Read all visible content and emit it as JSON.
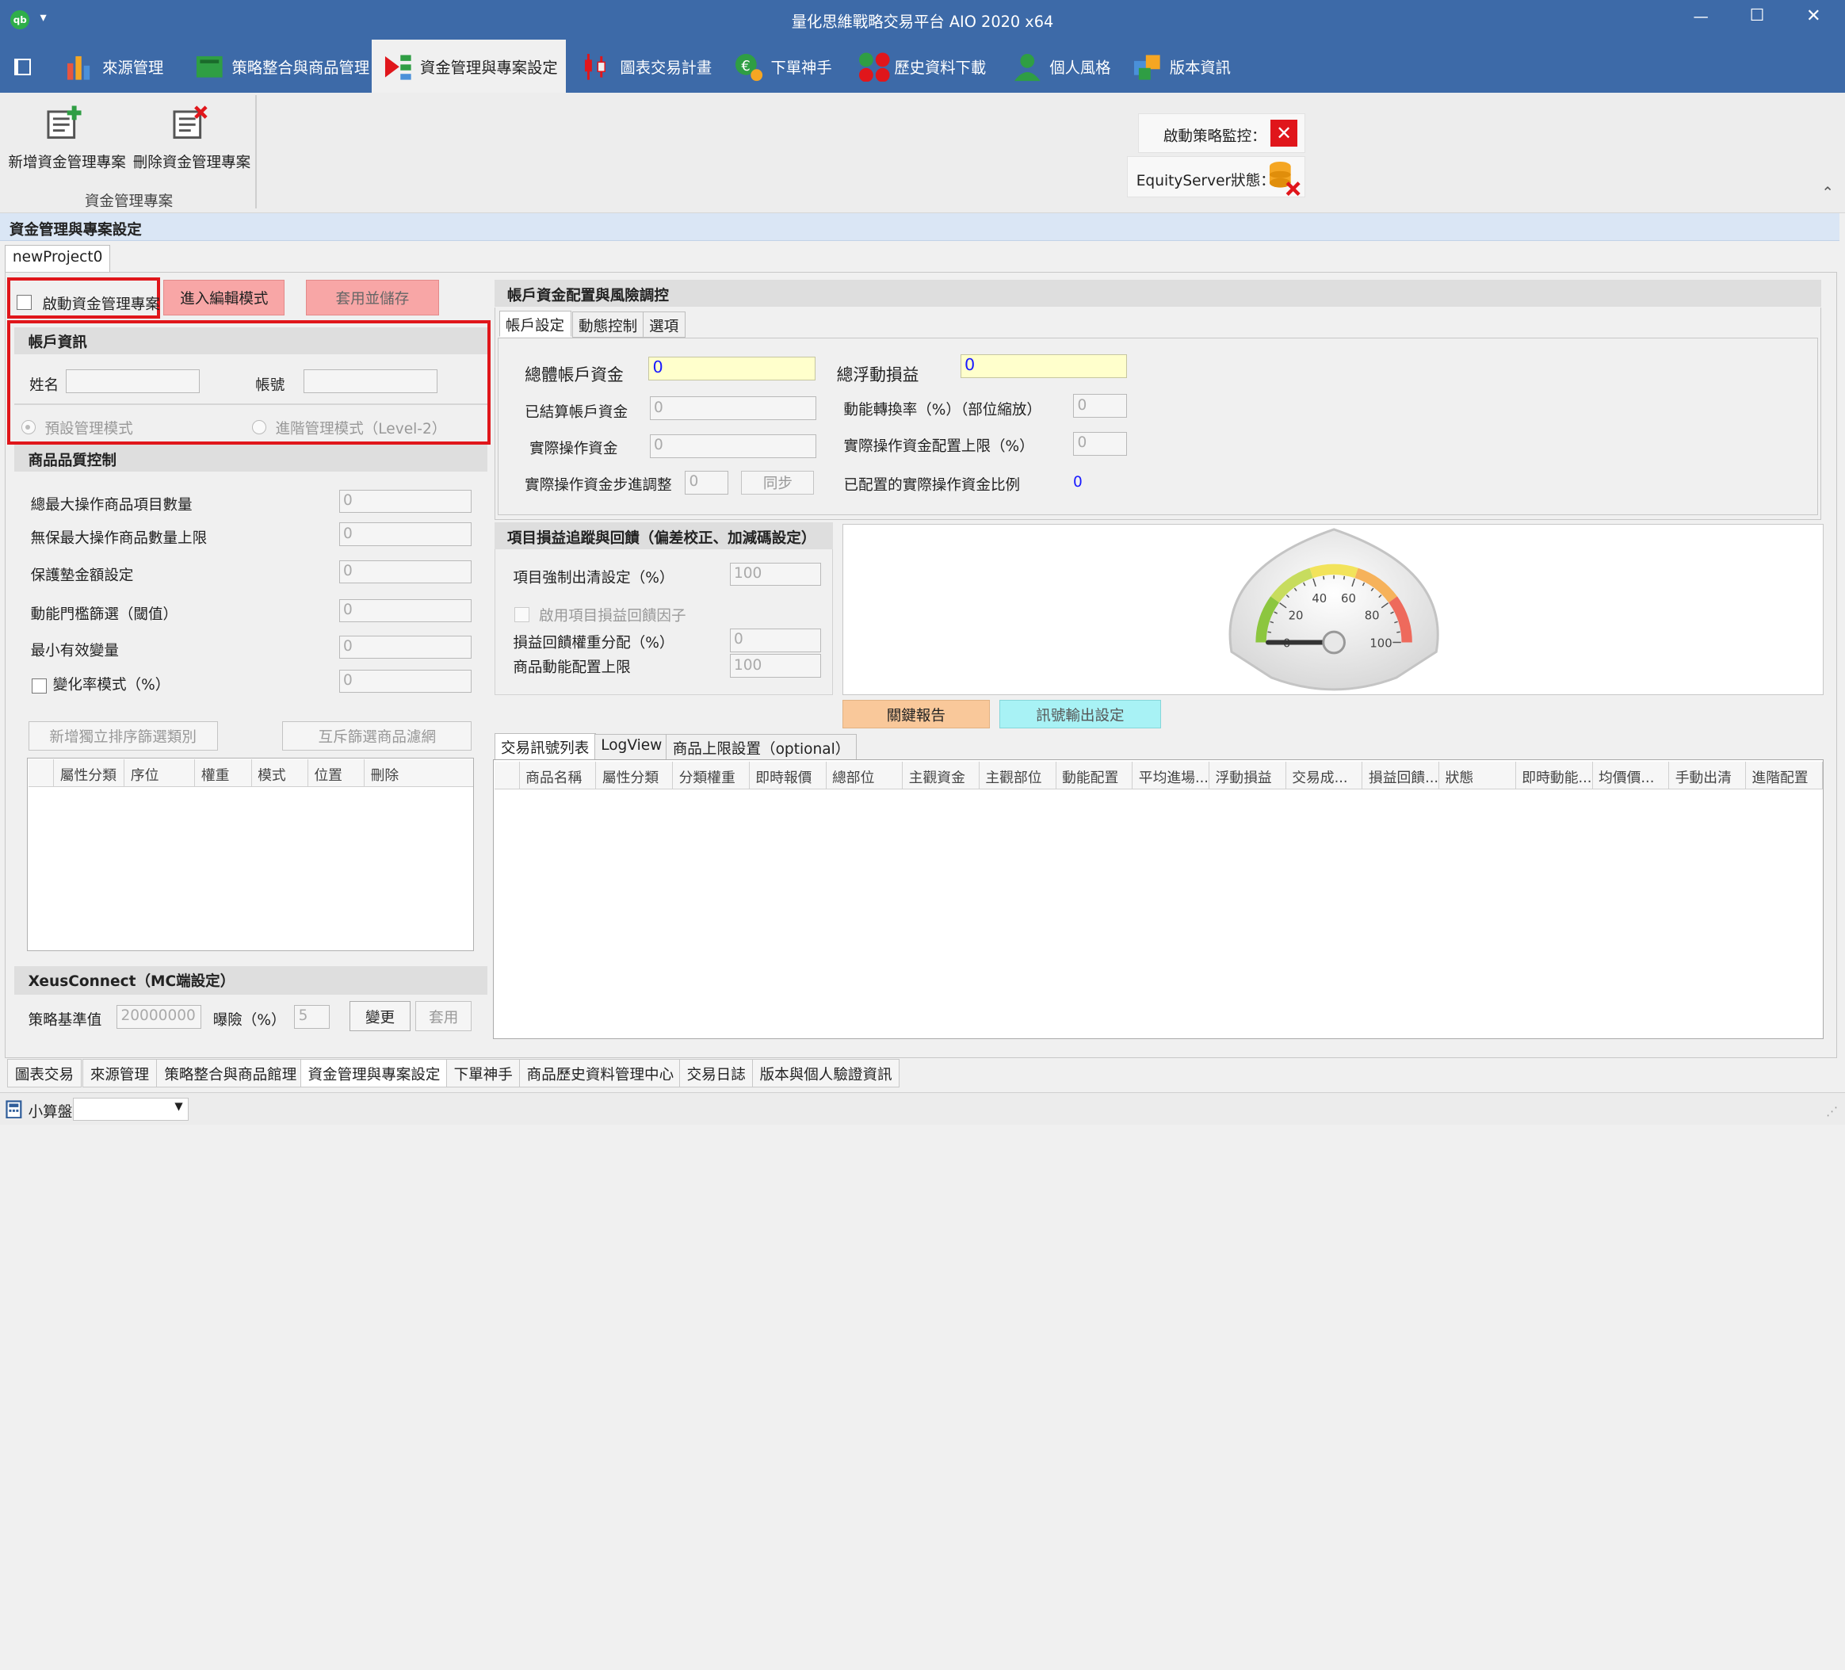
{
  "window": {
    "title": "量化思維戰略交易平台 AIO 2020 x64",
    "app_badge": "qb",
    "minimize": "—",
    "maximize": "☐",
    "close": "✕",
    "qat": "▾"
  },
  "ribbon_tabs": [
    {
      "label": "來源管理",
      "active": false
    },
    {
      "label": "策略整合與商品管理",
      "active": false
    },
    {
      "label": "資金管理與專案設定",
      "active": true
    },
    {
      "label": "圖表交易計畫",
      "active": false
    },
    {
      "label": "下單神手",
      "active": false
    },
    {
      "label": "歷史資料下載",
      "active": false
    },
    {
      "label": "個人風格",
      "active": false
    },
    {
      "label": "版本資訊",
      "active": false
    }
  ],
  "ribbon": {
    "add_label": "新增資金管理專案",
    "delete_label": "刪除資金管理專案",
    "group_label": "資金管理專案",
    "monitor_label": "啟動策略監控：",
    "equity_label": "EquityServer狀態："
  },
  "panel": {
    "title": "資金管理與專案設定",
    "project_tab": "newProject0"
  },
  "left": {
    "enable_label": "啟動資金管理專案",
    "edit_button": "進入編輯模式",
    "apply_button": "套用並儲存",
    "account": {
      "header": "帳戶資訊",
      "name_label": "姓名",
      "acct_label": "帳號",
      "mode_default": "預設管理模式",
      "mode_advanced": "進階管理模式（Level-2）"
    },
    "quality": {
      "header": "商品品質控制",
      "rows": [
        {
          "label": "總最大操作商品項目數量",
          "value": "0"
        },
        {
          "label": "無保最大操作商品數量上限",
          "value": "0"
        },
        {
          "label": "保護墊金額設定",
          "value": "0"
        },
        {
          "label": "動能門檻篩選（閾值）",
          "value": "0"
        },
        {
          "label": "最小有效變量",
          "value": "0"
        },
        {
          "label": "變化率模式（%）",
          "value": "0"
        }
      ],
      "add_sort_button": "新增獨立排序篩選類別",
      "mutex_button": "互斥篩選商品濾網",
      "columns": [
        "屬性分類",
        "序位",
        "權重",
        "模式",
        "位置",
        "刪除"
      ]
    },
    "xeus": {
      "header": "XeusConnect（MC端設定）",
      "base_label": "策略基準值",
      "base_value": "20000000",
      "exposure_label": "曝險（%）",
      "exposure_value": "5",
      "change_button": "變更",
      "apply_button": "套用"
    }
  },
  "right": {
    "header": "帳戶資金配置與風險調控",
    "tabs": [
      "帳戶設定",
      "動態控制",
      "選項"
    ],
    "fields": {
      "total_label": "總體帳戶資金",
      "total_value": "0",
      "float_label": "總浮動損益",
      "float_value": "0",
      "settled_label": "已結算帳戶資金",
      "settled_value": "0",
      "momentum_label": "動能轉換率（%）（部位縮放）",
      "momentum_value": "0",
      "actual_label": "實際操作資金",
      "actual_value": "0",
      "cap_label": "實際操作資金配置上限（%）",
      "cap_value": "0",
      "step_label": "實際操作資金步進調整",
      "step_value": "0",
      "sync_button": "同步",
      "ratio_label": "已配置的實際操作資金比例",
      "ratio_value": "0"
    },
    "tracking": {
      "header": "項目損益追蹤與回饋（偏差校正、加減碼設定）",
      "force_label": "項目強制出清設定（%）",
      "force_value": "100",
      "feedback_label": "啟用項目損益回饋因子",
      "weight_label": "損益回饋權重分配（%）",
      "weight_value": "0",
      "cap_label": "商品動能配置上限",
      "cap_value": "100"
    },
    "gauge": {
      "ticks": [
        "0",
        "20",
        "40",
        "60",
        "80",
        "100"
      ],
      "value": 0,
      "max": 100
    },
    "report_button": "關鍵報告",
    "signal_button": "訊號輸出設定",
    "bottom_tabs": [
      "交易訊號列表",
      "LogView",
      "商品上限設置（optional）"
    ],
    "columns": [
      "商品名稱",
      "屬性分類",
      "分類權重",
      "即時報價",
      "總部位",
      "主觀資金",
      "主觀部位",
      "動能配置",
      "平均進場...",
      "浮動損益",
      "交易成...",
      "損益回饋...",
      "狀態",
      "即時動能...",
      "均價價...",
      "手動出清",
      "進階配置"
    ]
  },
  "bottom_tabs": [
    "圖表交易",
    "來源管理",
    "策略整合與商品館理",
    "資金管理與專案設定",
    "下單神手",
    "商品歷史資料管理中心",
    "交易日誌",
    "版本與個人驗證資訊"
  ],
  "status": {
    "calculator_label": "小算盤"
  },
  "colors": {
    "titlebar": "#3d6aa8",
    "accent_red": "#e0161b",
    "pink_button": "#f8a6a6",
    "orange_button": "#f9c89a",
    "cyan_button": "#a8f2f5",
    "input_yellow": "#ffffcc"
  }
}
